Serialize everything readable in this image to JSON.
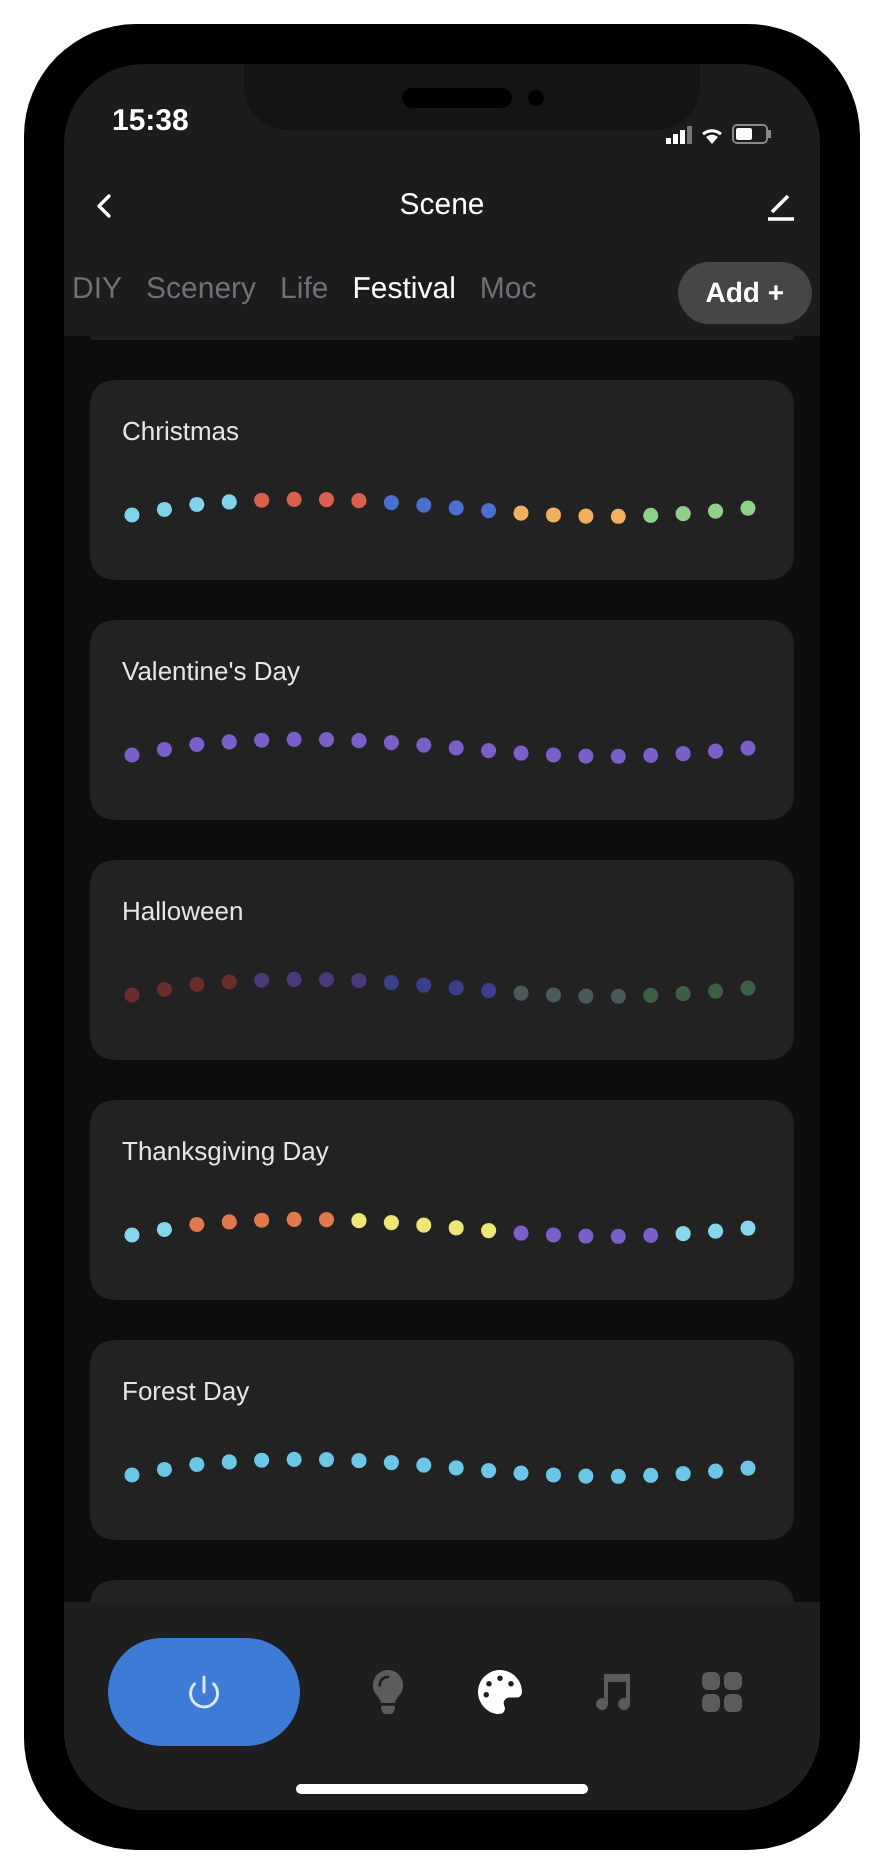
{
  "status_bar": {
    "time": "15:38"
  },
  "header": {
    "title": "Scene"
  },
  "tabs": [
    {
      "label": "DIY",
      "selected": false
    },
    {
      "label": "Scenery",
      "selected": false
    },
    {
      "label": "Life",
      "selected": false
    },
    {
      "label": "Festival",
      "selected": true
    },
    {
      "label": "Moc",
      "selected": false
    }
  ],
  "add_button": {
    "label": "Add +"
  },
  "scenes": [
    {
      "name": "Christmas",
      "dots": [
        {
          "color": "#7fd3ea"
        },
        {
          "color": "#7fd3ea"
        },
        {
          "color": "#7fd3ea"
        },
        {
          "color": "#7fd3ea"
        },
        {
          "color": "#d9604a"
        },
        {
          "color": "#d9604a"
        },
        {
          "color": "#d9604a"
        },
        {
          "color": "#d9604a"
        },
        {
          "color": "#4a6fd0"
        },
        {
          "color": "#4a6fd0"
        },
        {
          "color": "#4a6fd0"
        },
        {
          "color": "#4a6fd0"
        },
        {
          "color": "#f0b060"
        },
        {
          "color": "#f0b060"
        },
        {
          "color": "#f0b060"
        },
        {
          "color": "#f0b060"
        },
        {
          "color": "#8fd08a"
        },
        {
          "color": "#8fd08a"
        },
        {
          "color": "#8fd08a"
        },
        {
          "color": "#8fd08a"
        }
      ]
    },
    {
      "name": "Valentine's Day",
      "dots": [
        {
          "color": "#7b5fc9"
        },
        {
          "color": "#7b5fc9"
        },
        {
          "color": "#7b5fc9"
        },
        {
          "color": "#7b5fc9"
        },
        {
          "color": "#7b5fc9"
        },
        {
          "color": "#7b5fc9"
        },
        {
          "color": "#7b5fc9"
        },
        {
          "color": "#7b5fc9"
        },
        {
          "color": "#7b5fc9"
        },
        {
          "color": "#7b5fc9"
        },
        {
          "color": "#7b5fc9"
        },
        {
          "color": "#7b5fc9"
        },
        {
          "color": "#7b5fc9"
        },
        {
          "color": "#7b5fc9"
        },
        {
          "color": "#7b5fc9"
        },
        {
          "color": "#7b5fc9"
        },
        {
          "color": "#7b5fc9"
        },
        {
          "color": "#7b5fc9"
        },
        {
          "color": "#7b5fc9"
        },
        {
          "color": "#7b5fc9"
        }
      ]
    },
    {
      "name": "Halloween",
      "dots": [
        {
          "color": "#6b2c2c"
        },
        {
          "color": "#6b2c2c"
        },
        {
          "color": "#6b2c2c"
        },
        {
          "color": "#6b2c2c"
        },
        {
          "color": "#4b3a7a"
        },
        {
          "color": "#4b3a7a"
        },
        {
          "color": "#4b3a7a"
        },
        {
          "color": "#4b3a7a"
        },
        {
          "color": "#3a3f8a"
        },
        {
          "color": "#3a3f8a"
        },
        {
          "color": "#3a3f8a"
        },
        {
          "color": "#3a3f8a"
        },
        {
          "color": "#4a5a5a"
        },
        {
          "color": "#4a5a5a"
        },
        {
          "color": "#4a5a5a"
        },
        {
          "color": "#4a5a5a"
        },
        {
          "color": "#3f5f45"
        },
        {
          "color": "#3f5f45"
        },
        {
          "color": "#3f5f45"
        },
        {
          "color": "#3f5f45"
        }
      ]
    },
    {
      "name": "Thanksgiving Day",
      "dots": [
        {
          "color": "#86d6ec"
        },
        {
          "color": "#86d6ec"
        },
        {
          "color": "#e07a4e"
        },
        {
          "color": "#e07a4e"
        },
        {
          "color": "#e07a4e"
        },
        {
          "color": "#e07a4e"
        },
        {
          "color": "#e07a4e"
        },
        {
          "color": "#efe67a"
        },
        {
          "color": "#efe67a"
        },
        {
          "color": "#efe67a"
        },
        {
          "color": "#efe67a"
        },
        {
          "color": "#efe67a"
        },
        {
          "color": "#7b5fc9"
        },
        {
          "color": "#7b5fc9"
        },
        {
          "color": "#7b5fc9"
        },
        {
          "color": "#7b5fc9"
        },
        {
          "color": "#7b5fc9"
        },
        {
          "color": "#86d6ec"
        },
        {
          "color": "#86d6ec"
        },
        {
          "color": "#86d6ec"
        }
      ]
    },
    {
      "name": "Forest Day",
      "dots": [
        {
          "color": "#6cc6e6"
        },
        {
          "color": "#6cc6e6"
        },
        {
          "color": "#6cc6e6"
        },
        {
          "color": "#6cc6e6"
        },
        {
          "color": "#6cc6e6"
        },
        {
          "color": "#6cc6e6"
        },
        {
          "color": "#6cc6e6"
        },
        {
          "color": "#6cc6e6"
        },
        {
          "color": "#6cc6e6"
        },
        {
          "color": "#6cc6e6"
        },
        {
          "color": "#6cc6e6"
        },
        {
          "color": "#6cc6e6"
        },
        {
          "color": "#6cc6e6"
        },
        {
          "color": "#6cc6e6"
        },
        {
          "color": "#6cc6e6"
        },
        {
          "color": "#6cc6e6"
        },
        {
          "color": "#6cc6e6"
        },
        {
          "color": "#6cc6e6"
        },
        {
          "color": "#6cc6e6"
        },
        {
          "color": "#6cc6e6"
        }
      ]
    }
  ],
  "power_button": {
    "on": true
  },
  "nav": [
    {
      "kind": "bulb",
      "selected": false
    },
    {
      "kind": "palette",
      "selected": true
    },
    {
      "kind": "music",
      "selected": false
    },
    {
      "kind": "grid",
      "selected": false
    }
  ]
}
